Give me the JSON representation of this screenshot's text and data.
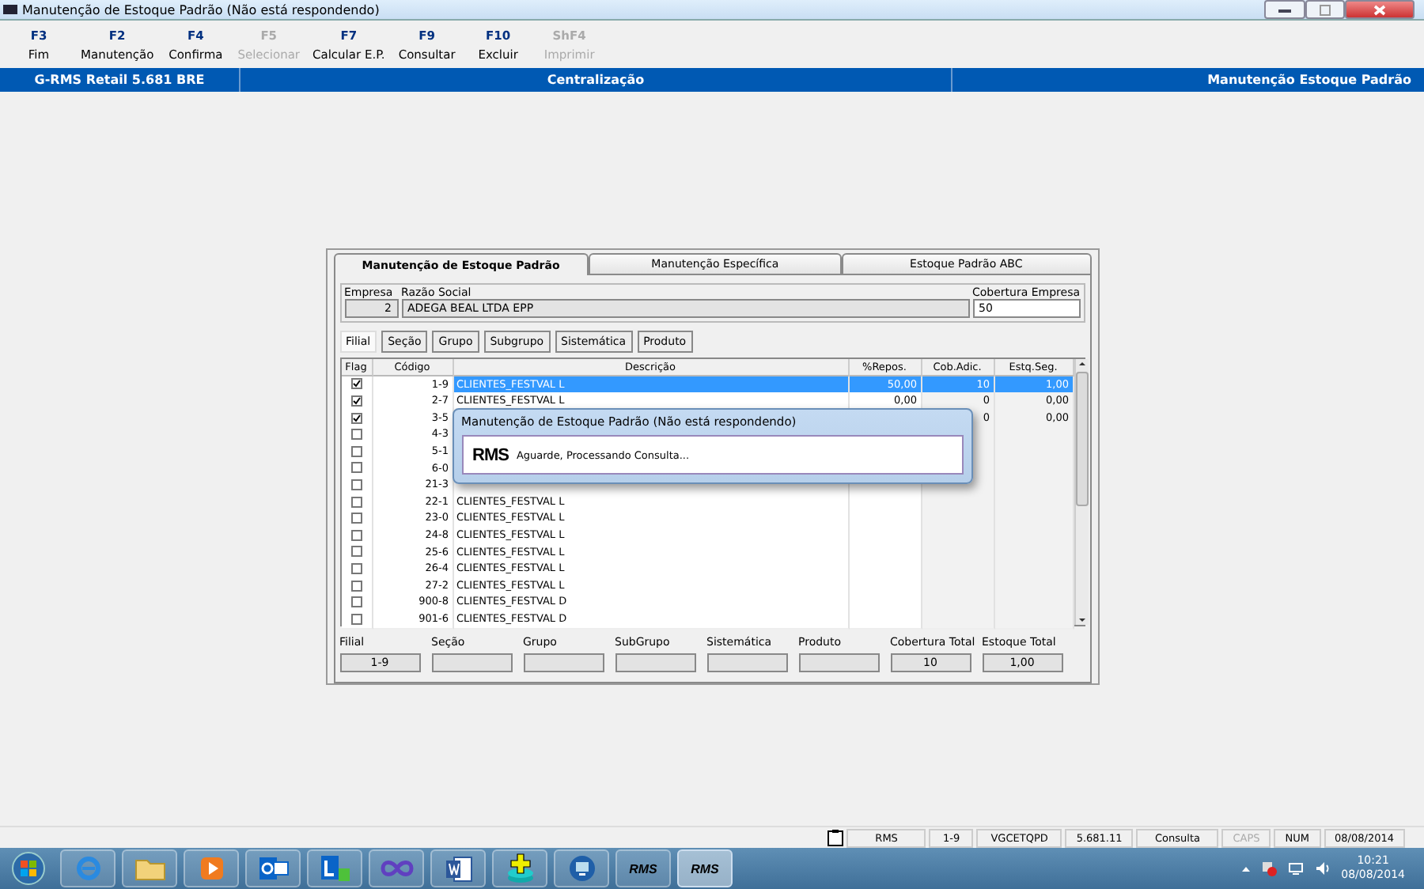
{
  "window": {
    "title": "Manutenção de Estoque Padrão (Não está respondendo)"
  },
  "toolbar": [
    {
      "key": "F3",
      "label": "Fim",
      "disabled": false
    },
    {
      "key": "F2",
      "label": "Manutenção",
      "disabled": false
    },
    {
      "key": "F4",
      "label": "Confirma",
      "disabled": false
    },
    {
      "key": "F5",
      "label": "Selecionar",
      "disabled": true
    },
    {
      "key": "F7",
      "label": "Calcular E.P.",
      "disabled": false
    },
    {
      "key": "F9",
      "label": "Consultar",
      "disabled": false
    },
    {
      "key": "F10",
      "label": "Excluir",
      "disabled": false
    },
    {
      "key": "ShF4",
      "label": "Imprimir",
      "disabled": true
    }
  ],
  "header_bar": {
    "left": "G-RMS Retail 5.681 BRE",
    "center": "Centralização",
    "right": "Manutenção Estoque Padrão"
  },
  "tabs": [
    {
      "label": "Manutenção de Estoque Padrão",
      "selected": true
    },
    {
      "label": "Manutenção Específica",
      "selected": false
    },
    {
      "label": "Estoque Padrão ABC",
      "selected": false
    }
  ],
  "company": {
    "empresa_label": "Empresa",
    "empresa": "2",
    "razao_label": "Razão Social",
    "razao": "ADEGA BEAL LTDA EPP",
    "cobertura_label": "Cobertura Empresa",
    "cobertura": "50"
  },
  "filters": [
    {
      "label": "Filial",
      "selected": true
    },
    {
      "label": "Seção",
      "selected": false
    },
    {
      "label": "Grupo",
      "selected": false
    },
    {
      "label": "Subgrupo",
      "selected": false
    },
    {
      "label": "Sistemática",
      "selected": false
    },
    {
      "label": "Produto",
      "selected": false
    }
  ],
  "table": {
    "columns": [
      "Flag",
      "Código",
      "Descrição",
      "%Repos.",
      "Cob.Adic.",
      "Estq.Seg."
    ],
    "rows": [
      {
        "checked": true,
        "selected": true,
        "code": "1-9",
        "description": "CLIENTES_FESTVAL L",
        "repos": "50,00",
        "cob": "10",
        "estq": "1,00"
      },
      {
        "checked": true,
        "selected": false,
        "code": "2-7",
        "description": "CLIENTES_FESTVAL L",
        "repos": "0,00",
        "cob": "0",
        "estq": "0,00"
      },
      {
        "checked": true,
        "selected": false,
        "code": "3-5",
        "cob": "0",
        "estq": "0,00"
      },
      {
        "checked": false,
        "selected": false,
        "code": "4-3"
      },
      {
        "checked": false,
        "selected": false,
        "code": "5-1"
      },
      {
        "checked": false,
        "selected": false,
        "code": "6-0"
      },
      {
        "checked": false,
        "selected": false,
        "code": "21-3"
      },
      {
        "checked": false,
        "selected": false,
        "code": "22-1",
        "description": "CLIENTES_FESTVAL L"
      },
      {
        "checked": false,
        "selected": false,
        "code": "23-0",
        "description": "CLIENTES_FESTVAL L"
      },
      {
        "checked": false,
        "selected": false,
        "code": "24-8",
        "description": "CLIENTES_FESTVAL L"
      },
      {
        "checked": false,
        "selected": false,
        "code": "25-6",
        "description": "CLIENTES_FESTVAL L"
      },
      {
        "checked": false,
        "selected": false,
        "code": "26-4",
        "description": "CLIENTES_FESTVAL L"
      },
      {
        "checked": false,
        "selected": false,
        "code": "27-2",
        "description": "CLIENTES_FESTVAL L"
      },
      {
        "checked": false,
        "selected": false,
        "code": "900-8",
        "description": "CLIENTES_FESTVAL D"
      },
      {
        "checked": false,
        "selected": false,
        "code": "901-6",
        "description": "CLIENTES_FESTVAL D"
      }
    ]
  },
  "summary": [
    {
      "label": "Filial",
      "value": "1-9"
    },
    {
      "label": "Seção"
    },
    {
      "label": "Grupo"
    },
    {
      "label": "SubGrupo"
    },
    {
      "label": "Sistemática"
    },
    {
      "label": "Produto"
    },
    {
      "label": "Cobertura Total",
      "value": "10"
    },
    {
      "label": "Estoque Total",
      "value": "1,00"
    }
  ],
  "dialog": {
    "title": "Manutenção de Estoque Padrão (Não está respondendo)",
    "logo": "RMS",
    "message": "Aguarde, Processando Consulta..."
  },
  "status_bar": [
    {
      "text": "RMS",
      "disabled": false
    },
    {
      "text": "1-9",
      "disabled": false
    },
    {
      "text": "VGCETQPD",
      "disabled": false
    },
    {
      "text": "5.681.11",
      "disabled": false
    },
    {
      "text": "Consulta",
      "disabled": false
    },
    {
      "text": "CAPS",
      "disabled": true
    },
    {
      "text": "NUM",
      "disabled": false
    },
    {
      "text": "08/08/2014",
      "disabled": false
    }
  ],
  "taskbar": [
    {
      "kind": "browser",
      "selected": false
    },
    {
      "kind": "folder",
      "selected": false
    },
    {
      "kind": "media",
      "selected": false
    },
    {
      "kind": "mail",
      "selected": false
    },
    {
      "kind": "chat",
      "selected": false
    },
    {
      "kind": "infinity",
      "selected": false
    },
    {
      "kind": "document",
      "selected": false
    },
    {
      "kind": "database",
      "selected": false
    },
    {
      "kind": "remote",
      "selected": false
    },
    {
      "kind": "rms",
      "label": "RMS",
      "selected": false
    },
    {
      "kind": "rms",
      "label": "RMS",
      "selected": true
    }
  ],
  "clock": {
    "time": "10:21",
    "date": "08/08/2014"
  }
}
